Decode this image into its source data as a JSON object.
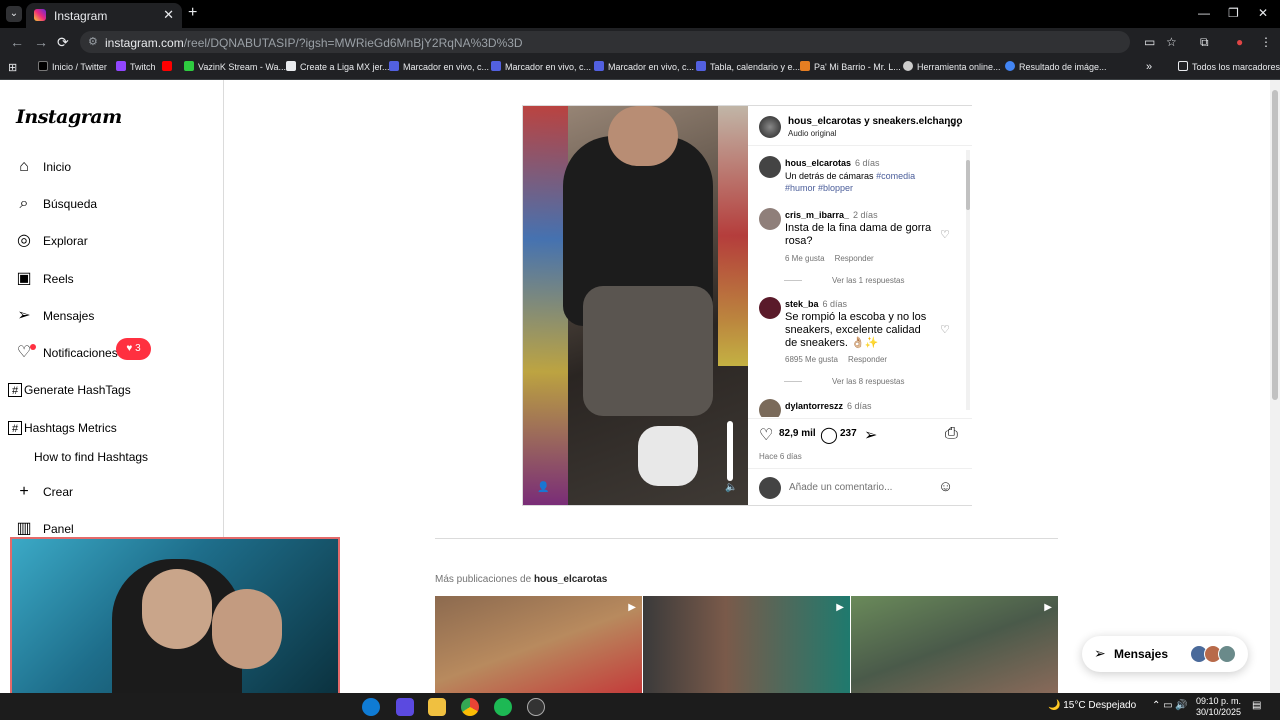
{
  "browser": {
    "tab_title": "Instagram",
    "url_host": "instagram.com",
    "url_path": "/reel/DQNABUTASIP/?igsh=MWRieGd6MnBjY2RqNA%3D%3D",
    "bookmarks": [
      "Inicio / Twitter",
      "Twitch",
      "",
      "VazinK Stream - Wa...",
      "Create a Liga MX jer...",
      "Marcador en vivo, c...",
      "Marcador en vivo, c...",
      "Marcador en vivo, c...",
      "Tabla, calendario y e...",
      "Pa' Mi Barrio - Mr. L...",
      "Herramienta online...",
      "Resultado de imáge..."
    ],
    "all_bookmarks": "Todos los marcadores"
  },
  "sidebar": {
    "logo": "Instagram",
    "items": [
      {
        "label": "Inicio",
        "icon": "home-icon"
      },
      {
        "label": "Búsqueda",
        "icon": "search-icon"
      },
      {
        "label": "Explorar",
        "icon": "compass-icon"
      },
      {
        "label": "Reels",
        "icon": "reels-icon"
      },
      {
        "label": "Mensajes",
        "icon": "send-icon"
      },
      {
        "label": "Notificaciones",
        "icon": "heart-icon"
      },
      {
        "label": "Generate HashTags",
        "icon": "hash-icon"
      },
      {
        "label": "Hashtags Metrics",
        "icon": "hash-icon"
      },
      {
        "label": "How to find Hashtags",
        "icon": ""
      },
      {
        "label": "Crear",
        "icon": "plus-icon"
      },
      {
        "label": "Panel",
        "icon": "chart-icon"
      }
    ],
    "notif_badge": "3"
  },
  "post": {
    "header_user": "hous_elcarotas y sneakers.elchango",
    "audio": "Audio original",
    "comments": [
      {
        "user": "hous_elcarotas",
        "ago": "6 días",
        "text": "Un detrás de cámaras",
        "tags": "#comedia #humor #blopper"
      },
      {
        "user": "cris_m_ibarra_",
        "ago": "2 días",
        "text": "Insta de la fina dama de gorra rosa?",
        "likes": "6 Me gusta",
        "reply": "Responder",
        "replies": "Ver las 1 respuestas"
      },
      {
        "user": "stek_ba",
        "ago": "6 días",
        "text": "Se rompió la escoba y no los sneakers, excelente calidad de sneakers. 👌🏼✨",
        "likes": "6895 Me gusta",
        "reply": "Responder",
        "replies": "Ver las 8 respuestas"
      },
      {
        "user": "dylantorreszz",
        "ago": "6 días",
        "text": ""
      }
    ],
    "likes_count": "82,9 mil",
    "comments_count": "237",
    "posted": "Hace 6 días",
    "add_comment_placeholder": "Añade un comentario..."
  },
  "more": {
    "prefix": "Más publicaciones de",
    "user": "hous_elcarotas"
  },
  "messages_button": "Mensajes",
  "taskbar": {
    "weather": "15°C  Despejado",
    "time": "09:10 p. m.",
    "date": "30/10/2025"
  },
  "colors": {
    "accent_red": "#ff3040",
    "link_blue": "#4a5d9a"
  }
}
